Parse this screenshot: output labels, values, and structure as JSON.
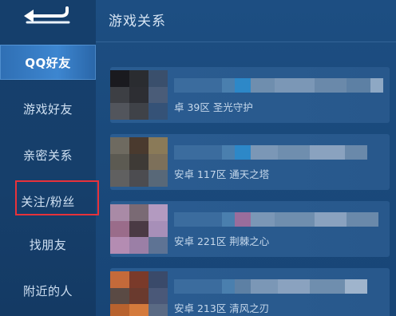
{
  "header": {
    "title": "游戏关系"
  },
  "sidebar": {
    "items": [
      {
        "label": "QQ好友",
        "active": true
      },
      {
        "label": "游戏好友",
        "active": false
      },
      {
        "label": "亲密关系",
        "active": false
      },
      {
        "label": "关注/粉丝",
        "active": false,
        "highlighted": true
      },
      {
        "label": "找朋友",
        "active": false
      },
      {
        "label": "附近的人",
        "active": false
      }
    ]
  },
  "friends": [
    {
      "region": "卓 39区 圣光守护"
    },
    {
      "region": "安卓 117区 通天之塔"
    },
    {
      "region": "安卓 221区 荆棘之心"
    },
    {
      "region": "安卓 213区 清风之刃"
    }
  ],
  "colors": {
    "background": "#1d4e82",
    "sidebar": "#153f6c",
    "active_tab": "#3d86d0",
    "highlight_box": "#e8323a",
    "card": "#2a5c91"
  },
  "icons": {
    "back": "back-arrow-icon"
  }
}
